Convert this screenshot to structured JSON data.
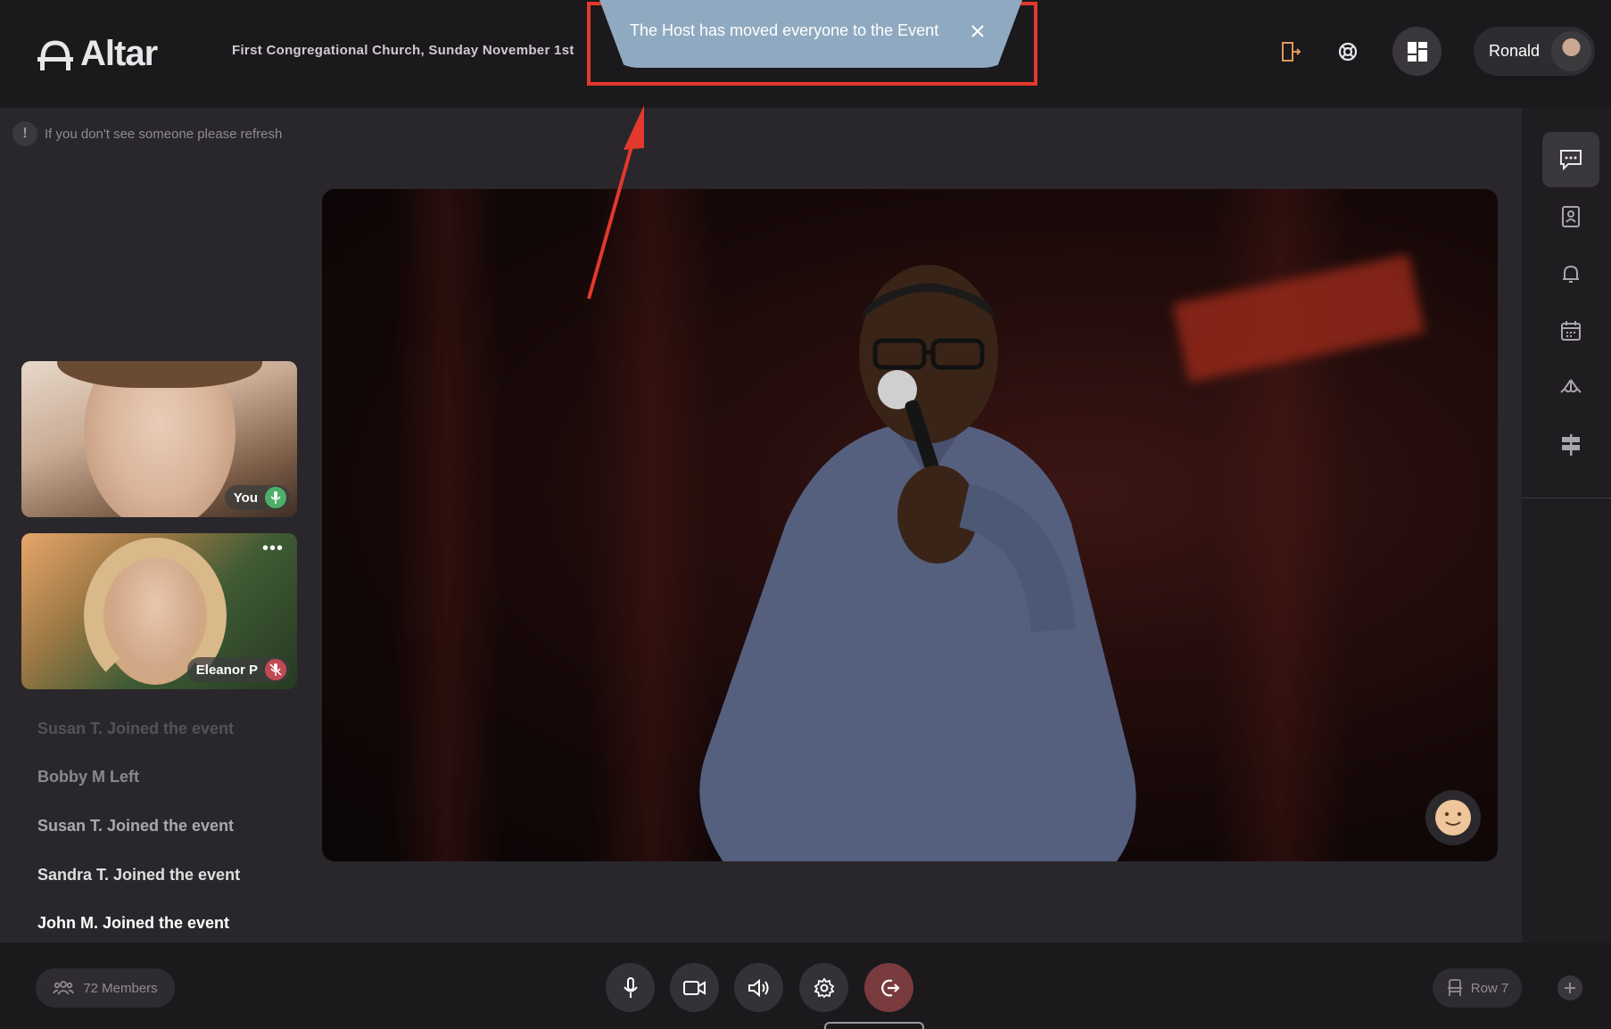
{
  "header": {
    "app_name": "Altar",
    "event_title": "First Congregational Church, Sunday November 1st",
    "user_name": "Ronald"
  },
  "toast": {
    "message": "The Host has moved everyone to the Event"
  },
  "stage": {
    "refresh_note": "If you don't see someone please refresh"
  },
  "tiles": [
    {
      "label": "You",
      "mic": "on"
    },
    {
      "label": "Eleanor P",
      "mic": "off"
    }
  ],
  "activity": [
    {
      "text": "Susan T. Joined the event",
      "opacity": 0.25
    },
    {
      "text": "Bobby M Left",
      "opacity": 0.45
    },
    {
      "text": "Susan T. Joined the event",
      "opacity": 0.65
    },
    {
      "text": "Sandra T. Joined the event",
      "opacity": 0.85
    },
    {
      "text": "John M. Joined the event",
      "opacity": 1.0
    }
  ],
  "bottom": {
    "members_label": "72 Members",
    "row_label": "Row 7"
  },
  "colors": {
    "accent_red": "#e2392c",
    "toast_bg": "#8faac0",
    "mic_on": "#4caf6a",
    "mic_off": "#c14a55"
  },
  "icons": {
    "exit": "door-exit-icon",
    "help": "lifebuoy-icon",
    "layout": "grid-layout-icon",
    "chat": "chat-icon",
    "contacts": "contacts-icon",
    "notifications": "bell-icon",
    "calendar": "calendar-icon",
    "prayer": "praying-hands-icon",
    "signpost": "signpost-icon"
  }
}
